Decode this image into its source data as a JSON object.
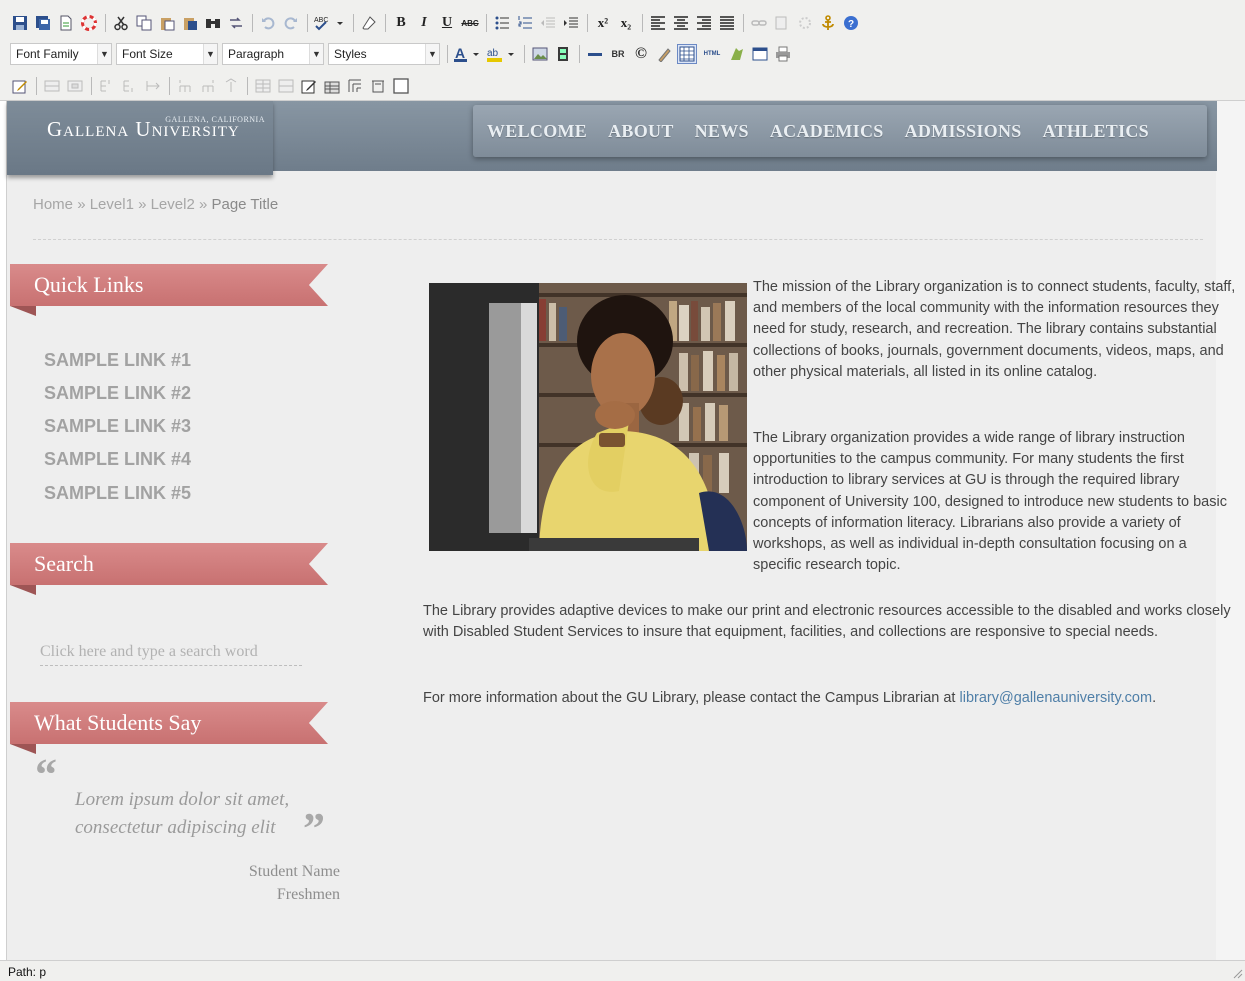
{
  "toolbar": {
    "font_family": "Font Family",
    "font_size": "Font Size",
    "paragraph": "Paragraph",
    "styles": "Styles",
    "bold_glyph": "B",
    "italic_glyph": "I",
    "underline_glyph": "U",
    "strike_glyph": "ABC",
    "br_glyph": "BR",
    "html_glyph": "HTML",
    "copyright_glyph": "©",
    "superscript_glyph": "x²",
    "subscript_glyph": "x₂"
  },
  "site": {
    "logo_sub": "GALLENA, CALIFORNIA",
    "logo_main": "Gallena University",
    "nav": [
      "WELCOME",
      "ABOUT",
      "NEWS",
      "ACADEMICS",
      "ADMISSIONS",
      "ATHLETICS"
    ]
  },
  "breadcrumb": {
    "home": "Home",
    "level1": "Level1",
    "level2": "Level2",
    "current": "Page Title",
    "sep": "»"
  },
  "sidebar": {
    "quick_links_title": "Quick Links",
    "links": [
      "SAMPLE LINK #1",
      "SAMPLE LINK #2",
      "SAMPLE LINK #3",
      "SAMPLE LINK #4",
      "SAMPLE LINK #5"
    ],
    "search_title": "Search",
    "search_placeholder": "Click here and type a search word",
    "students_title": "What Students Say",
    "quote_line1": "Lorem ipsum dolor sit amet,",
    "quote_line2": "consectetur adipiscing elit",
    "student_name": "Student Name",
    "student_year": "Freshmen",
    "quote_open": "“",
    "quote_close": "”"
  },
  "content": {
    "para1": "The mission of the Library organization is to connect students, faculty, staff, and members of the local community with the information resources they need for study, research, and recreation. The library contains substantial collections of books, journals, government documents, videos, maps, and other physical materials, all listed in its online catalog.",
    "para2": "The Library organization provides a wide range of library instruction opportunities to the campus community. For many students the first introduction to library services at GU is through the required library component of University 100, designed to introduce new students to basic concepts of information literacy. Librarians also provide a variety of workshops, as well as individual in-depth consultation focusing on a specific research topic.",
    "para3": "The Library provides adaptive devices to make our print and electronic resources accessible to the disabled and works closely with Disabled Student Services to insure that equipment, facilities, and collections are responsive to special needs.",
    "para4_prefix": "For more information about the GU Library, please contact the Campus Librarian at ",
    "email": "library@gallenauniversity.com",
    "para4_suffix": "."
  },
  "status": {
    "path": "Path: p"
  },
  "colors": {
    "ribbon": "#c87171",
    "header": "#7f8c99",
    "link": "#4f7fa8"
  }
}
